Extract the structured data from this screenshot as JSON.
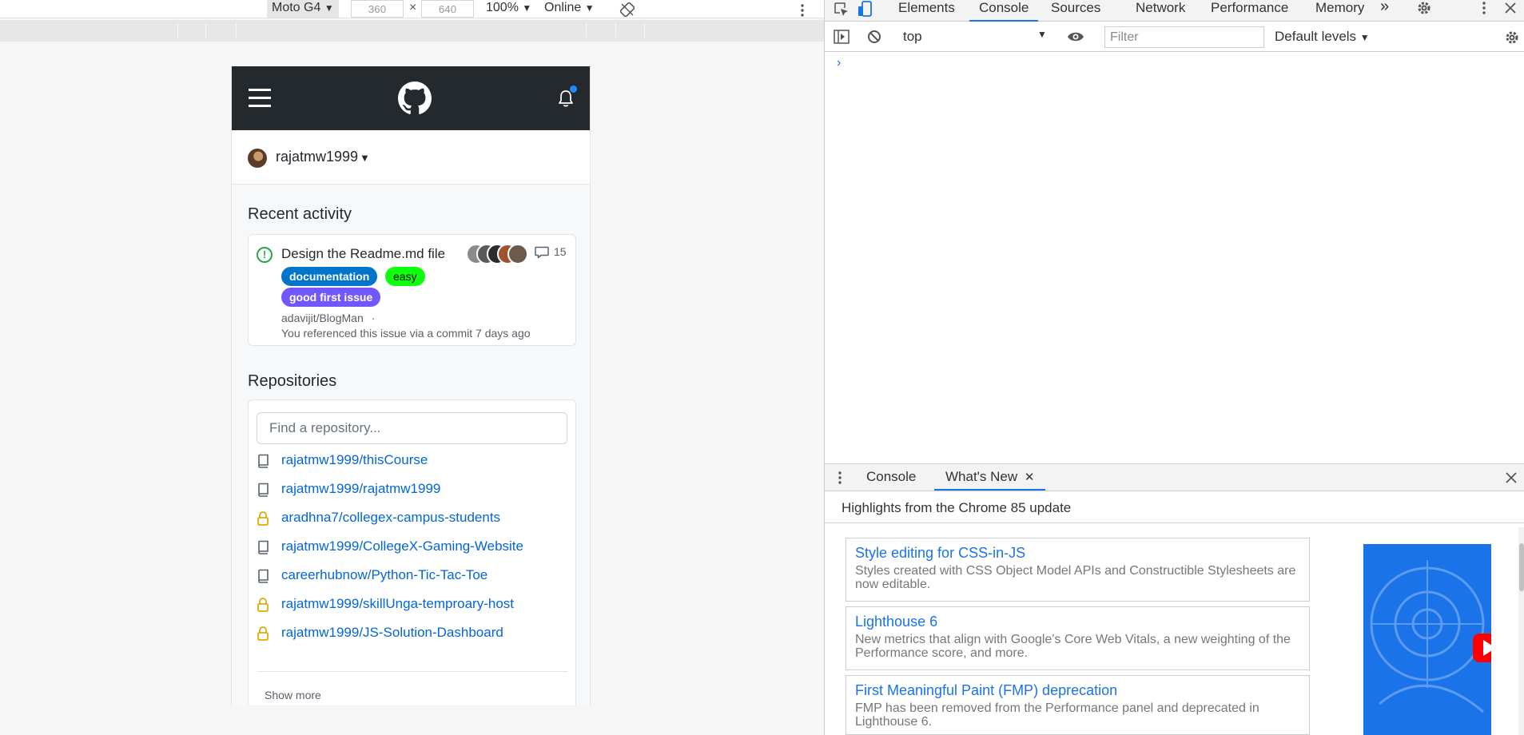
{
  "device_toolbar": {
    "device": "Moto G4",
    "width": "360",
    "times": "×",
    "height": "640",
    "zoom": "100%",
    "network": "Online",
    "caret": "▼"
  },
  "github": {
    "username": "rajatmw1999",
    "recent_activity_title": "Recent activity",
    "activity": {
      "title": "Design the Readme.md file",
      "comment_count": "15",
      "labels": [
        "documentation",
        "easy",
        "good first issue"
      ],
      "repo": "adavijit/BlogMan",
      "separator": "·",
      "meta": "You referenced this issue via a commit 7 days ago"
    },
    "repositories_title": "Repositories",
    "search_placeholder": "Find a repository...",
    "repos": [
      {
        "name": "rajatmw1999/thisCourse",
        "icon": "repo-icon"
      },
      {
        "name": "rajatmw1999/rajatmw1999",
        "icon": "repo-icon"
      },
      {
        "name": "aradhna7/collegex-campus-students",
        "icon": "lock-icon"
      },
      {
        "name": "rajatmw1999/CollegeX-Gaming-Website",
        "icon": "repo-icon"
      },
      {
        "name": "careerhubnow/Python-Tic-Tac-Toe",
        "icon": "repo-icon"
      },
      {
        "name": "rajatmw1999/skillUnga-temproary-host",
        "icon": "lock-icon"
      },
      {
        "name": "rajatmw1999/JS-Solution-Dashboard",
        "icon": "lock-icon"
      }
    ],
    "show_more": "Show more"
  },
  "devtools": {
    "tabs": [
      "Elements",
      "Console",
      "Sources",
      "Network",
      "Performance",
      "Memory"
    ],
    "more_tabs": "»",
    "context": "top",
    "filter_placeholder": "Filter",
    "levels": "Default levels",
    "prompt": "›",
    "drawer_tabs": {
      "console": "Console",
      "whats_new": "What's New",
      "close": "✕"
    },
    "highlights": "Highlights from the Chrome 85 update",
    "news": [
      {
        "title": "Style editing for CSS-in-JS",
        "desc": "Styles created with CSS Object Model APIs and Constructible Stylesheets are now editable."
      },
      {
        "title": "Lighthouse 6",
        "desc": "New metrics that align with Google's Core Web Vitals, a new weighting of the Performance score, and more."
      },
      {
        "title": "First Meaningful Paint (FMP) deprecation",
        "desc": "FMP has been removed from the Performance panel and deprecated in Lighthouse 6."
      }
    ]
  },
  "colors": {
    "github_header": "#24292e",
    "link": "#0366d6",
    "devtools_accent": "#1a73e8",
    "label_documentation": "#0075ca",
    "label_easy": "#0efe0e",
    "label_good_first_issue": "#7057ff"
  }
}
